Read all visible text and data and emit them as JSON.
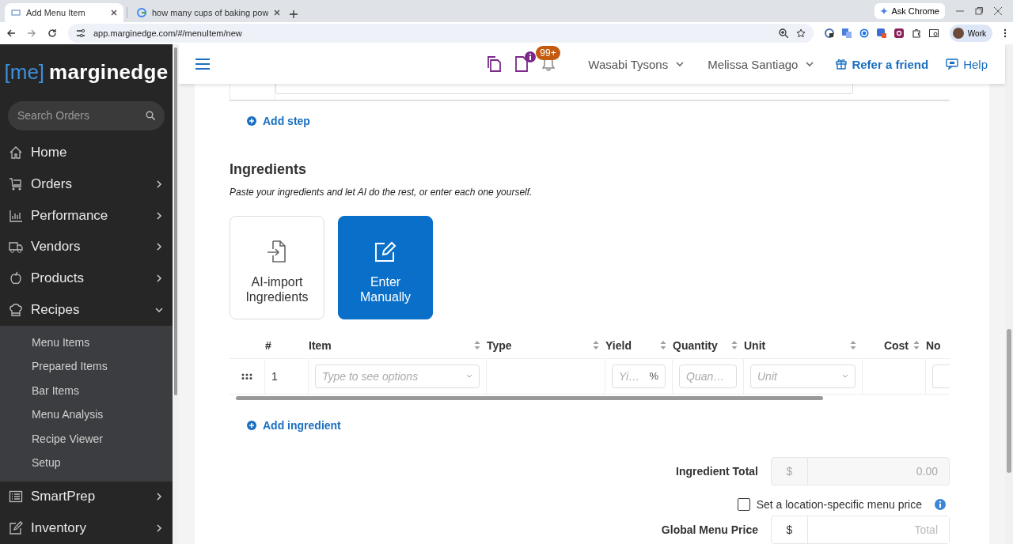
{
  "browser": {
    "tabs": [
      {
        "title": "Add Menu Item",
        "selected": true
      },
      {
        "title": "how many cups of baking pow",
        "selected": false
      }
    ],
    "ask_button": "Ask Chrome",
    "url": "app.marginedge.com/#/menuItem/new",
    "profile": "Work"
  },
  "sidebar": {
    "logo_mark": "[me]",
    "logo_text": "marginedge",
    "search": {
      "placeholder": "Search Orders"
    },
    "items": [
      {
        "label": "Home",
        "kind": "link"
      },
      {
        "label": "Orders",
        "kind": "menu",
        "expanded": false
      },
      {
        "label": "Performance",
        "kind": "menu",
        "expanded": false
      },
      {
        "label": "Vendors",
        "kind": "menu",
        "expanded": false
      },
      {
        "label": "Products",
        "kind": "menu",
        "expanded": false
      },
      {
        "label": "Recipes",
        "kind": "menu",
        "expanded": true,
        "children": [
          {
            "label": "Menu Items"
          },
          {
            "label": "Prepared Items"
          },
          {
            "label": "Bar Items"
          },
          {
            "label": "Menu Analysis"
          },
          {
            "label": "Recipe Viewer"
          },
          {
            "label": "Setup"
          }
        ]
      },
      {
        "label": "SmartPrep",
        "kind": "menu",
        "expanded": false
      },
      {
        "label": "Inventory",
        "kind": "menu",
        "expanded": false
      }
    ]
  },
  "topbar": {
    "notifications": "99+",
    "location": "Wasabi Tysons",
    "user": "Melissa Santiago",
    "refer": "Refer a friend",
    "help": "Help"
  },
  "steps": {
    "add_label": "Add step"
  },
  "ingredients": {
    "title": "Ingredients",
    "subtitle": "Paste your ingredients and let AI do the rest, or enter each one yourself.",
    "modes": [
      {
        "label": "AI-import Ingredients",
        "selected": false
      },
      {
        "label": "Enter Manually",
        "selected": true
      }
    ],
    "table": {
      "columns": [
        "#",
        "Item",
        "Type",
        "Yield",
        "Quantity",
        "Unit",
        "Cost",
        "No"
      ],
      "rows": [
        {
          "number": "1",
          "item": {
            "placeholder": "Type to see options"
          },
          "yield": {
            "placeholder": "Yi…",
            "suffix": "%"
          },
          "quantity": {
            "placeholder": "Quan…"
          },
          "unit": {
            "placeholder": "Unit"
          }
        }
      ]
    },
    "add_label": "Add ingredient"
  },
  "totals": {
    "ingredient_total": {
      "label": "Ingredient Total",
      "currency": "$",
      "value": "0.00"
    },
    "location_price": {
      "label": "Set a location-specific menu price",
      "checked": false
    },
    "global_price": {
      "label": "Global Menu Price",
      "currency": "$",
      "placeholder": "Total"
    }
  }
}
